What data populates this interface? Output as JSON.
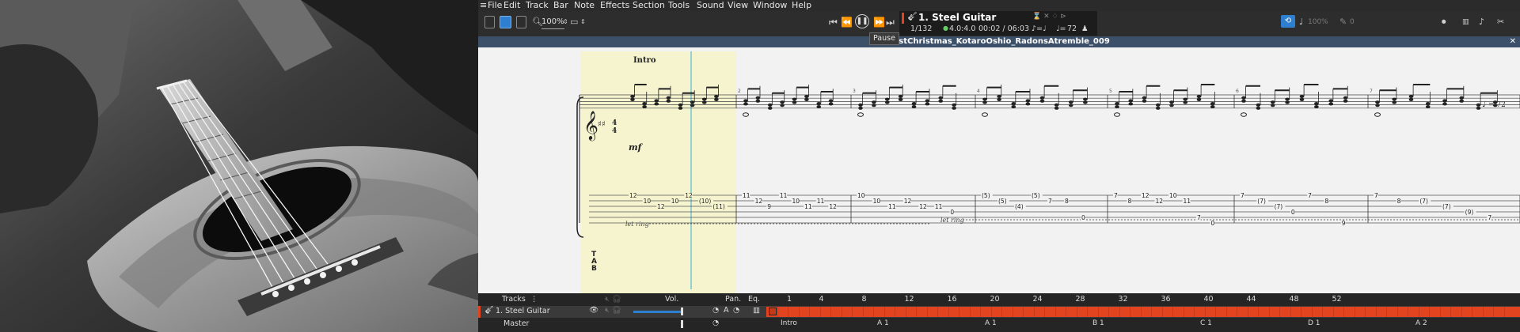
{
  "menu": [
    "File",
    "Edit",
    "Track",
    "Bar",
    "Note",
    "Effects",
    "Section",
    "Tools",
    "Sound",
    "View",
    "Window",
    "Help"
  ],
  "toolbar": {
    "zoom": "100%",
    "track_title": "1. Steel Guitar",
    "bar_position": "1/132",
    "time_signature": "4.0:4.0",
    "time": "00:02 / 06:03",
    "tempo": "72",
    "tooltip": "Pause",
    "speed": "100%",
    "count": "0"
  },
  "document_title": "LastChristmas_KotaroOshio_RadonsAtremble_009",
  "score": {
    "section_label": "Intro",
    "dynamic": "mf",
    "let_ring_1": "let ring",
    "let_ring_2": "let ring",
    "tempo_mark": "= 72",
    "tab_label": "T A B",
    "bar_numbers": [
      "2",
      "3",
      "4",
      "5",
      "6",
      "7",
      "8"
    ],
    "tab_bars": [
      [
        {
          "t": "12",
          "s": 0
        },
        {
          "t": "10",
          "s": 1
        },
        {
          "t": "12",
          "s": 2
        },
        {
          "t": "10",
          "s": 1
        },
        {
          "t": "12",
          "s": 0
        },
        {
          "t": "(10)",
          "s": 1
        },
        {
          "t": "(11)",
          "s": 2
        }
      ],
      [
        {
          "t": "11",
          "s": 0
        },
        {
          "t": "12",
          "s": 1
        },
        {
          "t": "9",
          "s": 2
        },
        {
          "t": "11",
          "s": 0
        },
        {
          "t": "10",
          "s": 1
        },
        {
          "t": "11",
          "s": 2
        },
        {
          "t": "11",
          "s": 1
        },
        {
          "t": "12",
          "s": 2
        }
      ],
      [
        {
          "t": "10",
          "s": 0
        },
        {
          "t": "10",
          "s": 1
        },
        {
          "t": "11",
          "s": 2
        },
        {
          "t": "12",
          "s": 1
        },
        {
          "t": "12",
          "s": 2
        },
        {
          "t": "11",
          "s": 2
        },
        {
          "t": "0",
          "s": 3
        }
      ],
      [
        {
          "t": "(5)",
          "s": 0
        },
        {
          "t": "(5)",
          "s": 1
        },
        {
          "t": "(4)",
          "s": 2
        },
        {
          "t": "(5)",
          "s": 0
        },
        {
          "t": "7",
          "s": 1
        },
        {
          "t": "8",
          "s": 1
        },
        {
          "t": "0",
          "s": 4
        }
      ],
      [
        {
          "t": "7",
          "s": 0
        },
        {
          "t": "8",
          "s": 1
        },
        {
          "t": "12",
          "s": 0
        },
        {
          "t": "12",
          "s": 1
        },
        {
          "t": "10",
          "s": 0
        },
        {
          "t": "11",
          "s": 1
        },
        {
          "t": "7",
          "s": 4
        },
        {
          "t": "0",
          "s": 5
        }
      ],
      [
        {
          "t": "7",
          "s": 0
        },
        {
          "t": "(7)",
          "s": 1
        },
        {
          "t": "(7)",
          "s": 2
        },
        {
          "t": "0",
          "s": 3
        },
        {
          "t": "7",
          "s": 0
        },
        {
          "t": "8",
          "s": 1
        },
        {
          "t": "9",
          "s": 5
        }
      ],
      [
        {
          "t": "7",
          "s": 0
        },
        {
          "t": "8",
          "s": 1
        },
        {
          "t": "(7)",
          "s": 1
        },
        {
          "t": "(7)",
          "s": 2
        },
        {
          "t": "(9)",
          "s": 3
        },
        {
          "t": "7",
          "s": 4
        }
      ]
    ]
  },
  "tracks_panel": {
    "header": "Tracks",
    "vol_label": "Vol.",
    "pan_label": "Pan.",
    "eq_label": "Eq.",
    "timeline_numbers": [
      "1",
      "4",
      "8",
      "12",
      "16",
      "20",
      "24",
      "28",
      "32",
      "36",
      "40",
      "44",
      "48",
      "52"
    ],
    "track_name": "1. Steel Guitar",
    "master_label": "Master",
    "markers": [
      {
        "key": "intro",
        "label": "Intro"
      },
      {
        "key": "a1",
        "label": "A 1"
      },
      {
        "key": "a1b",
        "label": "A 1"
      },
      {
        "key": "b1",
        "label": "B 1"
      },
      {
        "key": "c1",
        "label": "C 1"
      },
      {
        "key": "d1",
        "label": "D 1"
      },
      {
        "key": "a2",
        "label": "A 2"
      }
    ],
    "track_color": "#e2441f"
  },
  "colors": {
    "title_bar": "#3c5069",
    "intro_highlight": "#f5f4cf",
    "cursor": "#74c5cf",
    "accent_blue": "#2f7fd0"
  }
}
